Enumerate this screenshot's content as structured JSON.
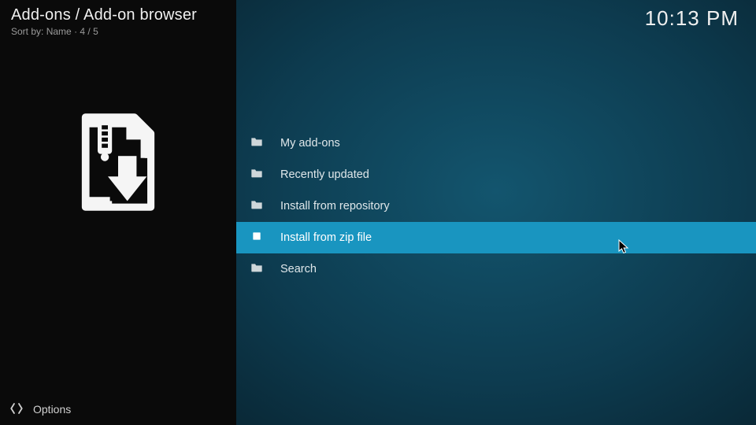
{
  "header": {
    "breadcrumb": "Add-ons / Add-on browser",
    "sort_label": "Sort by:",
    "sort_value": "Name",
    "position": "4 / 5"
  },
  "clock": "10:13 PM",
  "menu": {
    "items": [
      {
        "label": "My add-ons",
        "icon": "folder-icon",
        "selected": false
      },
      {
        "label": "Recently updated",
        "icon": "folder-icon",
        "selected": false
      },
      {
        "label": "Install from repository",
        "icon": "folder-icon",
        "selected": false
      },
      {
        "label": "Install from zip file",
        "icon": "file-icon",
        "selected": true
      },
      {
        "label": "Search",
        "icon": "folder-icon",
        "selected": false
      }
    ]
  },
  "footer": {
    "options_label": "Options"
  },
  "colors": {
    "highlight": "#1995c0",
    "sidebar_bg": "#0a0a0a"
  }
}
